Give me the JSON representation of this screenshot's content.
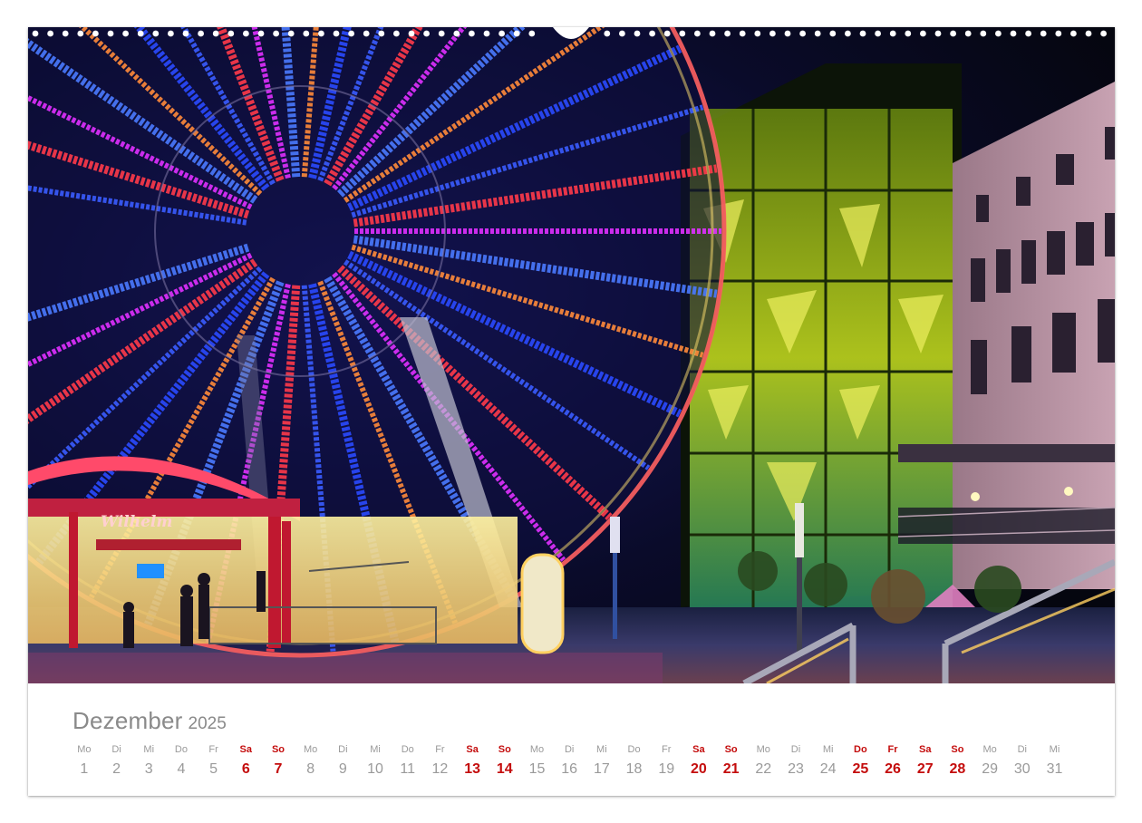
{
  "calendar": {
    "month": "Dezember",
    "year": "2025",
    "weekend_color": "#c40d0d",
    "days": [
      {
        "name": "Mo",
        "num": "1",
        "weekend": false
      },
      {
        "name": "Di",
        "num": "2",
        "weekend": false
      },
      {
        "name": "Mi",
        "num": "3",
        "weekend": false
      },
      {
        "name": "Do",
        "num": "4",
        "weekend": false
      },
      {
        "name": "Fr",
        "num": "5",
        "weekend": false
      },
      {
        "name": "Sa",
        "num": "6",
        "weekend": true
      },
      {
        "name": "So",
        "num": "7",
        "weekend": true
      },
      {
        "name": "Mo",
        "num": "8",
        "weekend": false
      },
      {
        "name": "Di",
        "num": "9",
        "weekend": false
      },
      {
        "name": "Mi",
        "num": "10",
        "weekend": false
      },
      {
        "name": "Do",
        "num": "11",
        "weekend": false
      },
      {
        "name": "Fr",
        "num": "12",
        "weekend": false
      },
      {
        "name": "Sa",
        "num": "13",
        "weekend": true
      },
      {
        "name": "So",
        "num": "14",
        "weekend": true
      },
      {
        "name": "Mo",
        "num": "15",
        "weekend": false
      },
      {
        "name": "Di",
        "num": "16",
        "weekend": false
      },
      {
        "name": "Mi",
        "num": "17",
        "weekend": false
      },
      {
        "name": "Do",
        "num": "18",
        "weekend": false
      },
      {
        "name": "Fr",
        "num": "19",
        "weekend": false
      },
      {
        "name": "Sa",
        "num": "20",
        "weekend": true
      },
      {
        "name": "So",
        "num": "21",
        "weekend": true
      },
      {
        "name": "Mo",
        "num": "22",
        "weekend": false
      },
      {
        "name": "Di",
        "num": "23",
        "weekend": false
      },
      {
        "name": "Mi",
        "num": "24",
        "weekend": false
      },
      {
        "name": "Do",
        "num": "25",
        "weekend": true
      },
      {
        "name": "Fr",
        "num": "26",
        "weekend": true
      },
      {
        "name": "Sa",
        "num": "27",
        "weekend": true
      },
      {
        "name": "So",
        "num": "28",
        "weekend": true
      },
      {
        "name": "Mo",
        "num": "29",
        "weekend": false
      },
      {
        "name": "Di",
        "num": "30",
        "weekend": false
      },
      {
        "name": "Mi",
        "num": "31",
        "weekend": false
      }
    ]
  },
  "photo": {
    "subject": "ferris-wheel-night",
    "sign_text": "Wilhelm",
    "colors": {
      "sky": "#07081a",
      "wheel_blue": "#3a5cff",
      "wheel_red": "#ff3a4a",
      "wheel_magenta": "#e030ff",
      "facade_green": "#c8e020",
      "building_pink": "#c8a0b0"
    }
  }
}
